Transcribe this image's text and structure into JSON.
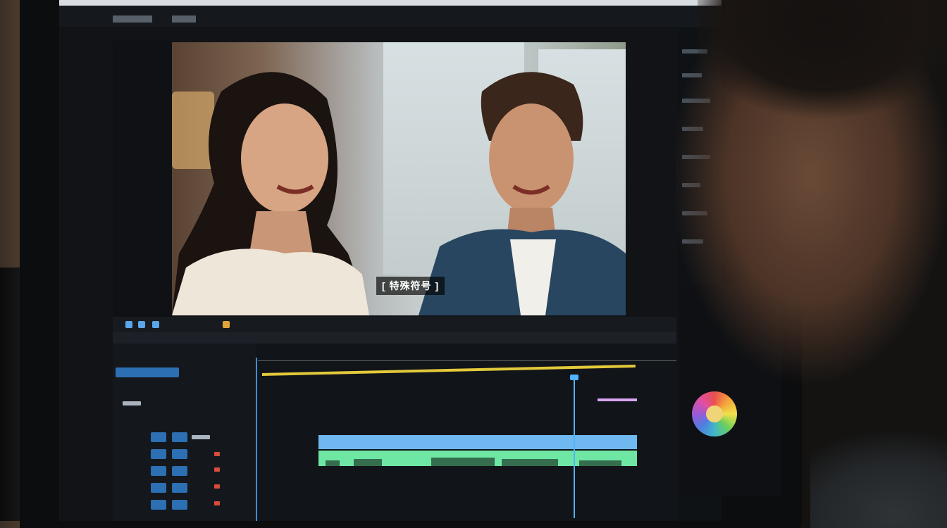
{
  "video": {
    "subtitle": "[ 特殊符号 ]",
    "description_hint": ""
  },
  "colors": {
    "accent_blue": "#4fb3ff",
    "audio_pink": "#d8a6f0",
    "audio_blue": "#6fb8f0",
    "video_green": "#6ee6a4",
    "marker_yellow": "#e3c93b"
  },
  "icons": {
    "playhead": "playhead-icon",
    "color_wheel": "color-wheel-icon"
  }
}
